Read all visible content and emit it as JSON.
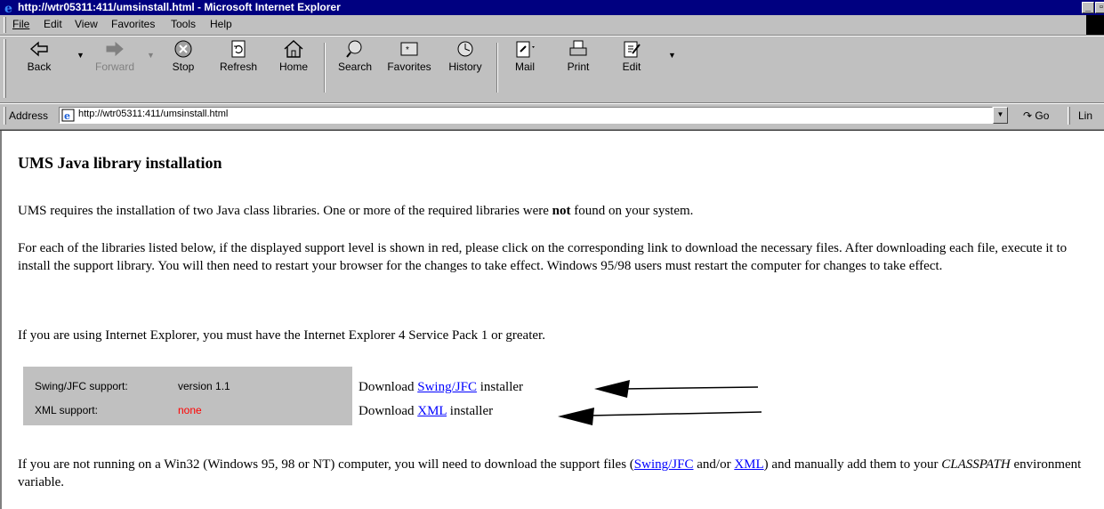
{
  "window": {
    "title": "http://wtr05311:411/umsinstall.html - Microsoft Internet Explorer"
  },
  "menu": [
    {
      "label": "File"
    },
    {
      "label": "Edit"
    },
    {
      "label": "View"
    },
    {
      "label": "Favorites"
    },
    {
      "label": "Tools"
    },
    {
      "label": "Help"
    }
  ],
  "toolbar": {
    "back": "Back",
    "forward": "Forward",
    "stop": "Stop",
    "refresh": "Refresh",
    "home": "Home",
    "search": "Search",
    "favorites": "Favorites",
    "history": "History",
    "mail": "Mail",
    "print": "Print",
    "edit": "Edit"
  },
  "address": {
    "label": "Address",
    "url": "http://wtr05311:411/umsinstall.html",
    "go": "Go",
    "links": "Lin"
  },
  "page": {
    "heading": "UMS Java library installation",
    "p1_a": "UMS requires the installation of two Java class libraries. One or more of the required libraries were ",
    "p1_bold": "not",
    "p1_b": " found on your system.",
    "p2": "For each of the libraries listed below, if the displayed support level is shown in red, please click on the corresponding link to download the necessary files. After downloading each file, execute it to install the support library. You will then need to restart your browser for the changes to take effect. Windows 95/98 users must restart the computer for changes to take effect.",
    "p3": "If you are using Internet Explorer, you must have the Internet Explorer 4 Service Pack 1 or greater.",
    "support": [
      {
        "label": "Swing/JFC support:",
        "value": "version 1.1",
        "value_color": "#000000"
      },
      {
        "label": "XML support:",
        "value": "none",
        "value_color": "#ff0000"
      }
    ],
    "downloads": [
      {
        "prefix": "Download ",
        "link": "Swing/JFC",
        "suffix": " installer"
      },
      {
        "prefix": "Download ",
        "link": "XML",
        "suffix": " installer"
      }
    ],
    "p4_a": "If you are not running on a Win32 (Windows 95, 98 or NT) computer, you will need to download the support files (",
    "p4_link1": "Swing/JFC",
    "p4_mid": " and/or ",
    "p4_link2": "XML",
    "p4_b": ") and manually add them to your ",
    "p4_italic": "CLASSPATH",
    "p4_c": " environment variable."
  },
  "colors": {
    "titlebar": "#000080",
    "chrome": "#c0c0c0",
    "link": "#0000ff",
    "error": "#ff0000"
  }
}
